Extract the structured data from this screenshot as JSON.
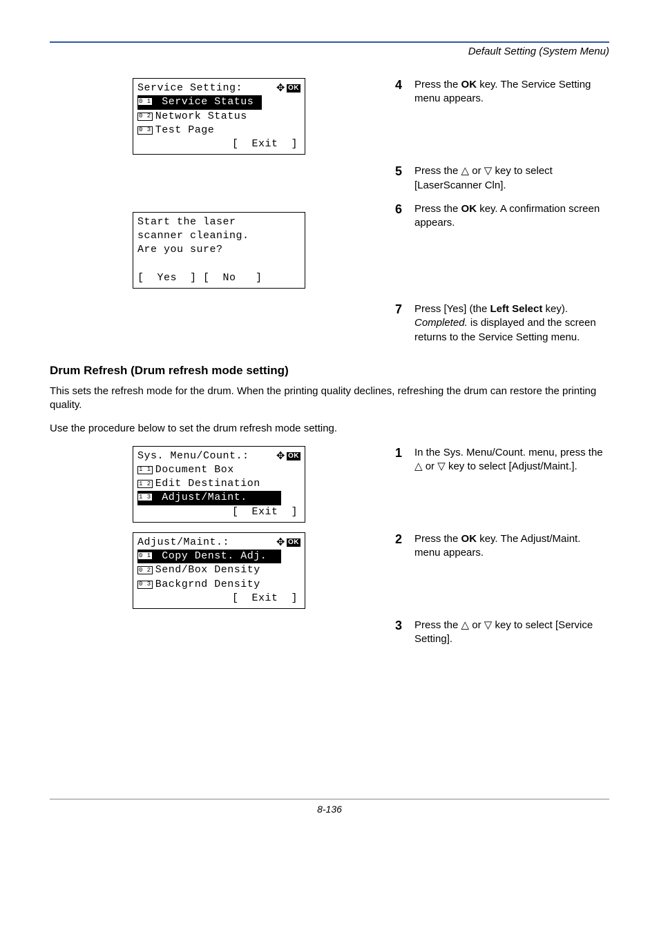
{
  "header": {
    "title": "Default Setting (System Menu)"
  },
  "lcd1": {
    "title": "Service Setting:",
    "item1_num": "0 1",
    "item1_label": " Service Status ",
    "item2_num": "0 2",
    "item2_label": "Network Status",
    "item3_num": "0 3",
    "item3_label": "Test Page",
    "exit": "[  Exit  ]"
  },
  "lcd2": {
    "l1": "Start the laser",
    "l2": "scanner cleaning.",
    "l3": "Are you sure?",
    "l4": "[  Yes  ] [  No   ]"
  },
  "lcd3": {
    "title": "Sys. Menu/Count.:",
    "item1_num": "1 1",
    "item1_label": "Document Box",
    "item2_num": "1 2",
    "item2_label": "Edit Destination",
    "item3_num": "1 3",
    "item3_label": " Adjust/Maint.     ",
    "exit": "[  Exit  ]"
  },
  "lcd4": {
    "title": "Adjust/Maint.:",
    "item1_num": "0 1",
    "item1_label": " Copy Denst. Adj.  ",
    "item2_num": "0 2",
    "item2_label": "Send/Box Density",
    "item3_num": "0 3",
    "item3_label": "Backgrnd Density",
    "exit": "[  Exit  ]"
  },
  "steps": {
    "s4_num": "4",
    "s4_a": "Press the ",
    "s4_b": "OK",
    "s4_c": " key. The Service Setting menu appears.",
    "s5_num": "5",
    "s5_a": "Press the ",
    "s5_b": " or ",
    "s5_c": " key to select [LaserScanner Cln].",
    "s6_num": "6",
    "s6_a": "Press the ",
    "s6_b": "OK",
    "s6_c": " key. A confirmation screen appears.",
    "s7_num": "7",
    "s7_a": "Press [Yes] (the ",
    "s7_b": "Left Select",
    "s7_c": " key). ",
    "s7_d": "Completed.",
    "s7_e": " is displayed and the screen returns to the Service Setting menu.",
    "s1b_num": "1",
    "s1b_a": "In the Sys. Menu/Count. menu, press the ",
    "s1b_b": " or ",
    "s1b_c": " key to select [Adjust/Maint.].",
    "s2b_num": "2",
    "s2b_a": "Press the ",
    "s2b_b": "OK",
    "s2b_c": " key. The Adjust/Maint. menu appears.",
    "s3b_num": "3",
    "s3b_a": "Press the ",
    "s3b_b": " or ",
    "s3b_c": " key to select [Service Setting]."
  },
  "section": {
    "heading": "Drum Refresh (Drum refresh mode setting)",
    "p1": "This sets the refresh mode for the drum. When the printing quality declines, refreshing the drum can restore the printing quality.",
    "p2": "Use the procedure below to set the drum refresh mode setting."
  },
  "footer": {
    "pagenum": "8-136"
  },
  "glyphs": {
    "up": "△",
    "down": "▽",
    "ok": "OK",
    "diamond": "✥"
  }
}
